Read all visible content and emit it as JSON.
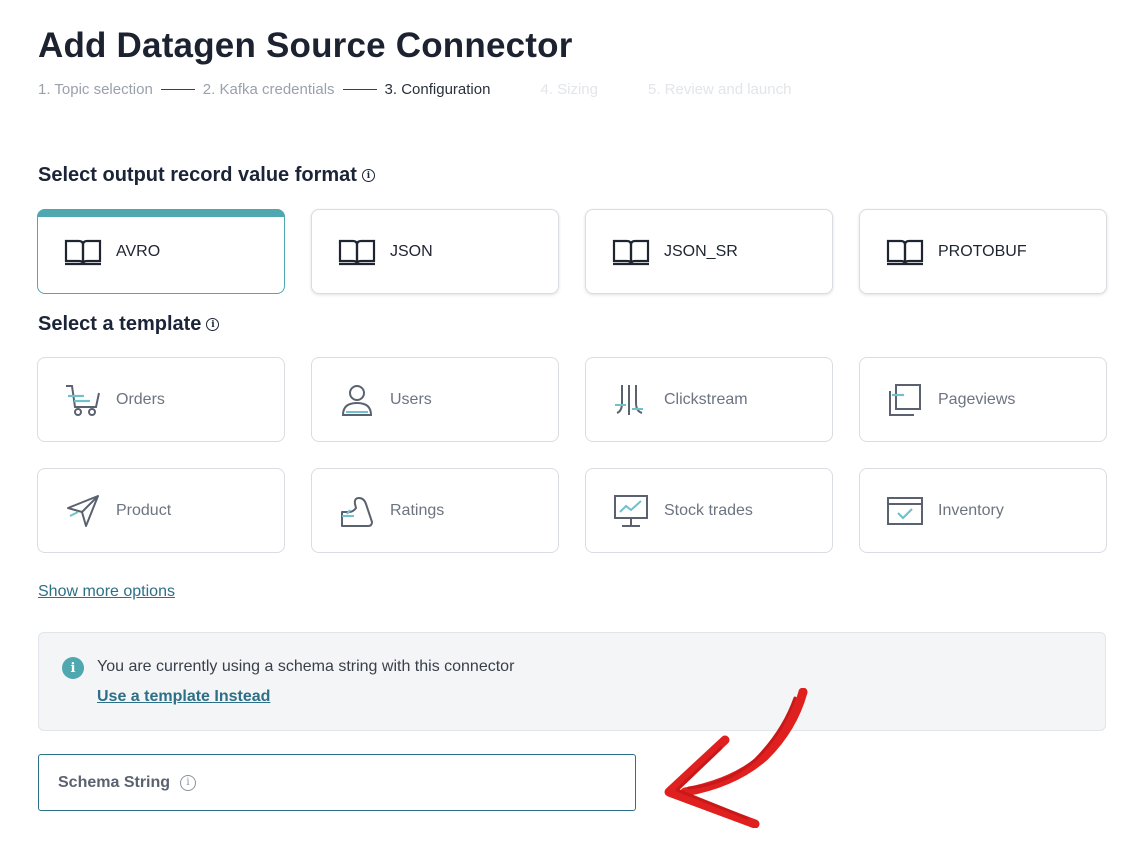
{
  "page": {
    "title": "Add Datagen Source Connector"
  },
  "steps": [
    {
      "label": "1. Topic selection",
      "state": "done"
    },
    {
      "label": "2. Kafka credentials",
      "state": "done"
    },
    {
      "label": "3. Configuration",
      "state": "current"
    },
    {
      "label": "4. Sizing",
      "state": "future"
    },
    {
      "label": "5. Review and launch",
      "state": "future"
    }
  ],
  "format_section": {
    "title": "Select output record value format",
    "options": [
      {
        "label": "AVRO",
        "icon": "book-icon",
        "selected": true
      },
      {
        "label": "JSON",
        "icon": "book-icon",
        "selected": false
      },
      {
        "label": "JSON_SR",
        "icon": "book-icon",
        "selected": false
      },
      {
        "label": "PROTOBUF",
        "icon": "book-icon",
        "selected": false
      }
    ]
  },
  "template_section": {
    "title": "Select a template",
    "options": [
      {
        "label": "Orders",
        "icon": "cart-icon"
      },
      {
        "label": "Users",
        "icon": "user-icon"
      },
      {
        "label": "Clickstream",
        "icon": "clickstream-icon"
      },
      {
        "label": "Pageviews",
        "icon": "pages-icon"
      },
      {
        "label": "Product",
        "icon": "send-icon"
      },
      {
        "label": "Ratings",
        "icon": "ratings-icon"
      },
      {
        "label": "Stock trades",
        "icon": "monitor-chart-icon"
      },
      {
        "label": "Inventory",
        "icon": "inventory-icon"
      }
    ],
    "show_more": "Show more options"
  },
  "notice": {
    "text": "You are currently using a schema string with this connector",
    "link": "Use a template Instead"
  },
  "schema_field": {
    "label": "Schema String"
  },
  "colors": {
    "accent": "#4fa7b0",
    "link": "#2d6f86",
    "annotation_arrow": "#e0201e"
  }
}
